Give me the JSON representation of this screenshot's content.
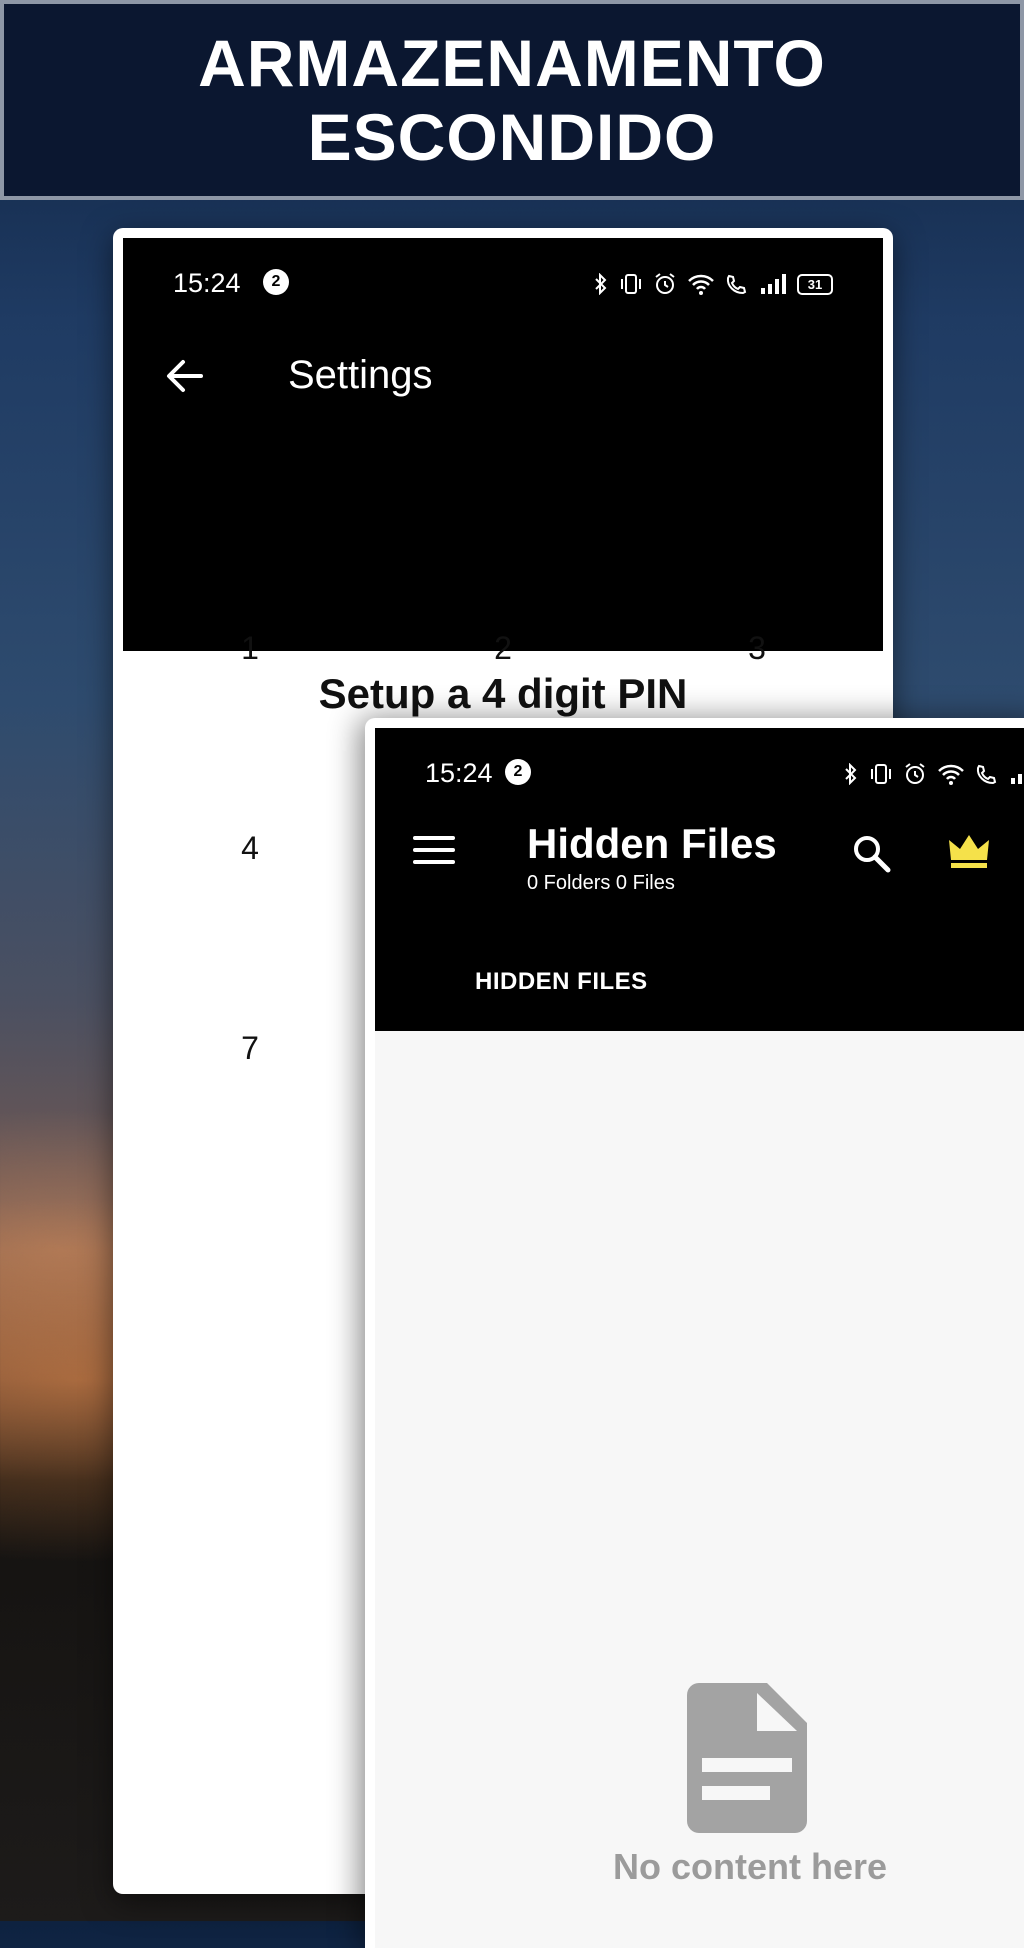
{
  "banner": {
    "title": "ARMAZENAMENTO ESCONDIDO"
  },
  "settings_screen": {
    "status_time": "15:24",
    "notification_count": "2",
    "battery": "31",
    "title": "Settings",
    "pin_title": "Setup a 4 digit PIN",
    "keys": [
      "1",
      "2",
      "3",
      "4",
      "7"
    ]
  },
  "hidden_files_screen": {
    "status_time": "15:24",
    "notification_count": "2",
    "title": "Hidden Files",
    "subtitle": "0 Folders 0 Files",
    "tab_label": "HIDDEN FILES",
    "empty_message": "No content here",
    "crown_color": "#f5e14a"
  },
  "icons": {
    "back": "arrow-left-icon",
    "menu": "hamburger-menu-icon",
    "search": "search-icon",
    "premium": "crown-icon",
    "empty": "document-icon"
  }
}
